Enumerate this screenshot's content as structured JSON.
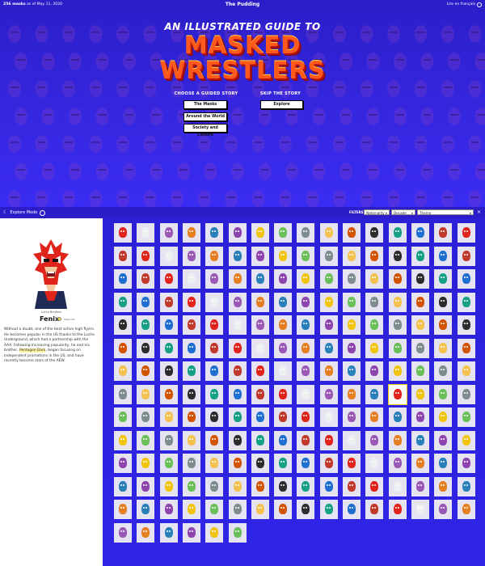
{
  "topbar": {
    "count_bold": "256 masks",
    "count_rest": "as of May 11, 2020",
    "brand": "The Pudding",
    "lang": "Lire en français"
  },
  "hero": {
    "title_top": "AN ILLUSTRATED GUIDE TO",
    "title_line1": "MASKED",
    "title_line2": "WRESTLERS",
    "guided_heading": "CHOOSE A GUIDED STORY",
    "guided_buttons": [
      "The Masks",
      "Around the World",
      "Society and Culture"
    ],
    "skip_heading": "SKIP THE STORY",
    "skip_button": "Explore"
  },
  "explore_bar": {
    "label": "Explore Mode",
    "filters_label": "FILTERS",
    "filters": [
      "Nationality",
      "Decade",
      "Theme"
    ]
  },
  "sidebar": {
    "logo_caption": "Lucha Brothers",
    "name": "Fenix",
    "more_label": "View info",
    "bio_parts": [
      "Without a doubt, one of the best active high flyers. He becomes popular in the US thanks to the Lucha Underground, which had a partnership with the AAA. Following increasing popularity, he and his brother, ",
      "Pentagon Dark",
      ", began focusing on independent promotions in the US, and have recently become stars of the AEW."
    ]
  },
  "grid": {
    "tile_count": 214,
    "selected_index": 124
  },
  "colors": {
    "background": "#2a1fd0",
    "title_fill": "#ff5a1c",
    "highlight": "#fdf3a1",
    "selected_outline": "#f1c40f"
  }
}
